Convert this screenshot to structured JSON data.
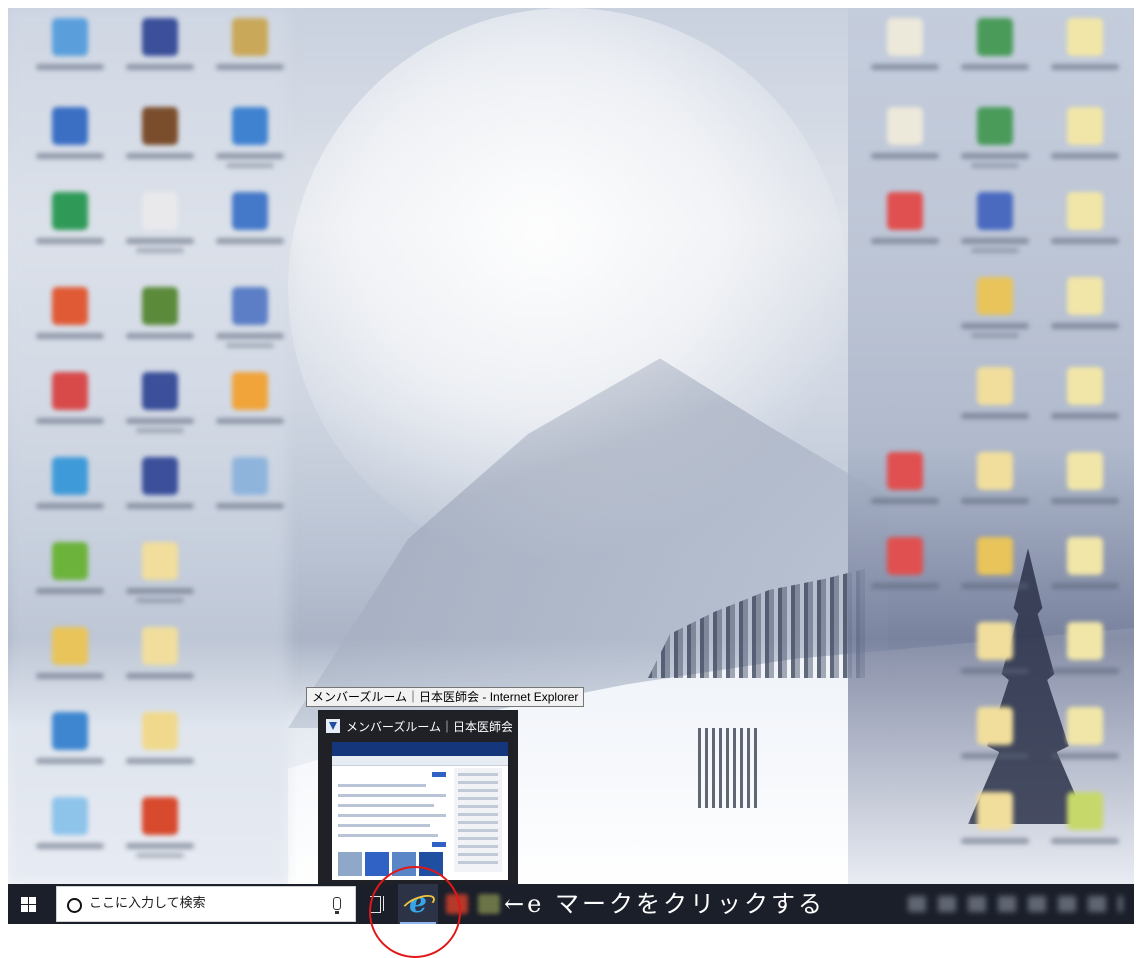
{
  "preview": {
    "tooltip": "メンバーズルーム｜日本医師会 - Internet Explorer",
    "card_title": "メンバーズルーム｜日本医師会 - In..."
  },
  "taskbar": {
    "search_placeholder": "ここに入力して検索",
    "pinned_app_icon": "internet-explorer-icon"
  },
  "annotation": {
    "instruction": "←e マークをクリックする",
    "highlight_color": "#e01818"
  },
  "colors": {
    "taskbar_bg": "#1b1f2a",
    "ie_blue": "#35a6e8",
    "ie_ring": "#f0c33b"
  }
}
